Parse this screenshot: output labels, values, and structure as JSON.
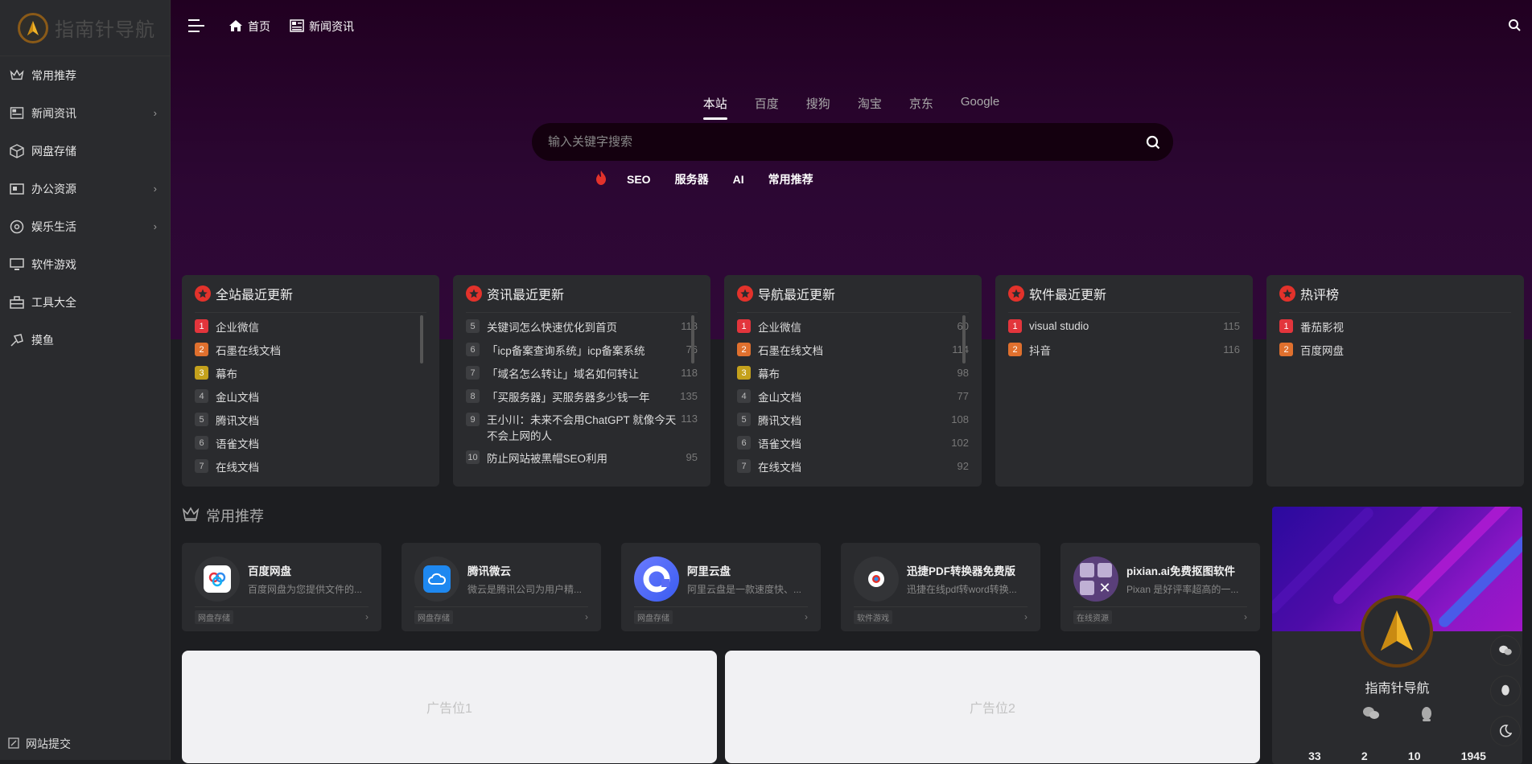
{
  "brand": {
    "name": "指南针导航"
  },
  "sidebar": {
    "items": [
      {
        "label": "常用推荐",
        "icon": "crown-icon",
        "has_sub": false
      },
      {
        "label": "新闻资讯",
        "icon": "newspaper-icon",
        "has_sub": true
      },
      {
        "label": "网盘存储",
        "icon": "box-icon",
        "has_sub": false
      },
      {
        "label": "办公资源",
        "icon": "office-icon",
        "has_sub": true
      },
      {
        "label": "娱乐生活",
        "icon": "disc-icon",
        "has_sub": true
      },
      {
        "label": "软件游戏",
        "icon": "monitor-icon",
        "has_sub": false
      },
      {
        "label": "工具大全",
        "icon": "toolbox-icon",
        "has_sub": false
      },
      {
        "label": "摸鱼",
        "icon": "fish-icon",
        "has_sub": false
      }
    ],
    "submit_label": "网站提交",
    "arrow": "›"
  },
  "topbar": {
    "home": "首页",
    "news": "新闻资讯"
  },
  "search": {
    "tabs": [
      "本站",
      "百度",
      "搜狗",
      "淘宝",
      "京东",
      "Google"
    ],
    "active_tab": 0,
    "placeholder": "输入关键字搜索",
    "hot_tags": [
      "SEO",
      "服务器",
      "AI",
      "常用推荐"
    ]
  },
  "panels": [
    {
      "title": "全站最近更新",
      "items": [
        {
          "n": "1",
          "t": "企业微信",
          "c": ""
        },
        {
          "n": "2",
          "t": "石墨在线文档",
          "c": ""
        },
        {
          "n": "3",
          "t": "幕布",
          "c": ""
        },
        {
          "n": "4",
          "t": "金山文档",
          "c": ""
        },
        {
          "n": "5",
          "t": "腾讯文档",
          "c": ""
        },
        {
          "n": "6",
          "t": "语雀文档",
          "c": ""
        },
        {
          "n": "7",
          "t": "在线文档",
          "c": ""
        }
      ]
    },
    {
      "title": "资讯最近更新",
      "items": [
        {
          "n": "5",
          "t": "关键词怎么快速优化到首页",
          "c": "118"
        },
        {
          "n": "6",
          "t": "「icp备案查询系统」icp备案系统",
          "c": "76"
        },
        {
          "n": "7",
          "t": "「域名怎么转让」域名如何转让",
          "c": "118"
        },
        {
          "n": "8",
          "t": "「买服务器」买服务器多少钱一年",
          "c": "135"
        },
        {
          "n": "9",
          "t": "王小川：未来不会用ChatGPT 就像今天不会上网的人",
          "c": "113"
        },
        {
          "n": "10",
          "t": "防止网站被黑帽SEO利用",
          "c": "95"
        }
      ]
    },
    {
      "title": "导航最近更新",
      "items": [
        {
          "n": "1",
          "t": "企业微信",
          "c": "60"
        },
        {
          "n": "2",
          "t": "石墨在线文档",
          "c": "114"
        },
        {
          "n": "3",
          "t": "幕布",
          "c": "98"
        },
        {
          "n": "4",
          "t": "金山文档",
          "c": "77"
        },
        {
          "n": "5",
          "t": "腾讯文档",
          "c": "108"
        },
        {
          "n": "6",
          "t": "语雀文档",
          "c": "102"
        },
        {
          "n": "7",
          "t": "在线文档",
          "c": "92"
        }
      ]
    },
    {
      "title": "软件最近更新",
      "items": [
        {
          "n": "1",
          "t": "visual studio",
          "c": "115"
        },
        {
          "n": "2",
          "t": "抖音",
          "c": "116"
        }
      ]
    },
    {
      "title": "热评榜",
      "items": [
        {
          "n": "1",
          "t": "番茄影视",
          "c": ""
        },
        {
          "n": "2",
          "t": "百度网盘",
          "c": ""
        }
      ]
    }
  ],
  "section": {
    "title": "常用推荐"
  },
  "cards": [
    {
      "name": "百度网盘",
      "desc": "百度网盘为您提供文件的...",
      "cat": "网盘存储",
      "icon": "baidu-netdisk-icon"
    },
    {
      "name": "腾讯微云",
      "desc": "微云是腾讯公司为用户精...",
      "cat": "网盘存储",
      "icon": "weiyun-icon"
    },
    {
      "name": "阿里云盘",
      "desc": "阿里云盘是一款速度快、...",
      "cat": "网盘存储",
      "icon": "aliyun-drive-icon"
    },
    {
      "name": "迅捷PDF转换器免费版",
      "desc": "迅捷在线pdf转word转换...",
      "cat": "软件游戏",
      "icon": "pdf-converter-icon"
    },
    {
      "name": "pixian.ai免费抠图软件",
      "desc": "Pixan 是好评率超高的一...",
      "cat": "在线资源",
      "icon": "pixian-icon"
    }
  ],
  "ads": [
    "广告位1",
    "广告位2"
  ],
  "profile": {
    "name": "指南针导航",
    "stats": [
      "33",
      "2",
      "10",
      "1945"
    ]
  },
  "colors": {
    "accent_red": "#e3322b",
    "hero_bg": "#2c0733",
    "panel_bg": "#2a2b2e"
  }
}
